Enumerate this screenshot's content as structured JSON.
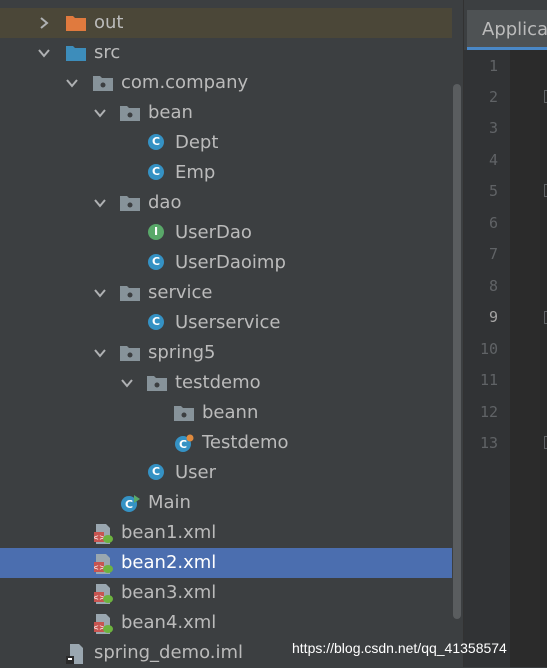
{
  "project_tree": {
    "items": [
      {
        "label": "out",
        "icon": "folder-excluded-icon",
        "expanded": false
      },
      {
        "label": "src",
        "icon": "source-folder-icon",
        "expanded": true
      },
      {
        "label": "com.company",
        "icon": "package-icon",
        "expanded": true
      },
      {
        "label": "bean",
        "icon": "package-icon",
        "expanded": true
      },
      {
        "label": "Dept",
        "icon": "class-icon"
      },
      {
        "label": "Emp",
        "icon": "class-icon"
      },
      {
        "label": "dao",
        "icon": "package-icon",
        "expanded": true
      },
      {
        "label": "UserDao",
        "icon": "interface-icon"
      },
      {
        "label": "UserDaoimp",
        "icon": "class-icon"
      },
      {
        "label": "service",
        "icon": "package-icon",
        "expanded": true
      },
      {
        "label": "Userservice",
        "icon": "class-icon"
      },
      {
        "label": "spring5",
        "icon": "package-icon",
        "expanded": true
      },
      {
        "label": "testdemo",
        "icon": "package-icon",
        "expanded": true
      },
      {
        "label": "beann",
        "icon": "package-icon"
      },
      {
        "label": "Testdemo",
        "icon": "test-class-icon"
      },
      {
        "label": "User",
        "icon": "class-icon"
      },
      {
        "label": "Main",
        "icon": "runnable-class-icon"
      },
      {
        "label": "bean1.xml",
        "icon": "spring-xml-icon"
      },
      {
        "label": "bean2.xml",
        "icon": "spring-xml-icon",
        "selected": true
      },
      {
        "label": "bean3.xml",
        "icon": "spring-xml-icon"
      },
      {
        "label": "bean4.xml",
        "icon": "spring-xml-icon"
      },
      {
        "label": "spring_demo.iml",
        "icon": "iml-file-icon"
      }
    ]
  },
  "editor": {
    "tab_label": "Applica",
    "line_numbers": [
      "1",
      "2",
      "3",
      "4",
      "5",
      "6",
      "7",
      "8",
      "9",
      "10",
      "11",
      "12",
      "13"
    ],
    "current_line": "9"
  },
  "watermark": "https://blog.csdn.net/qq_41358574",
  "colors": {
    "background": "#3c3f41",
    "selection": "#4b6eaf",
    "class": "#3592c4",
    "interface": "#59a869",
    "folder": "#87939a",
    "excluded_folder": "#e07a3e",
    "source_folder": "#3d8dbb"
  }
}
